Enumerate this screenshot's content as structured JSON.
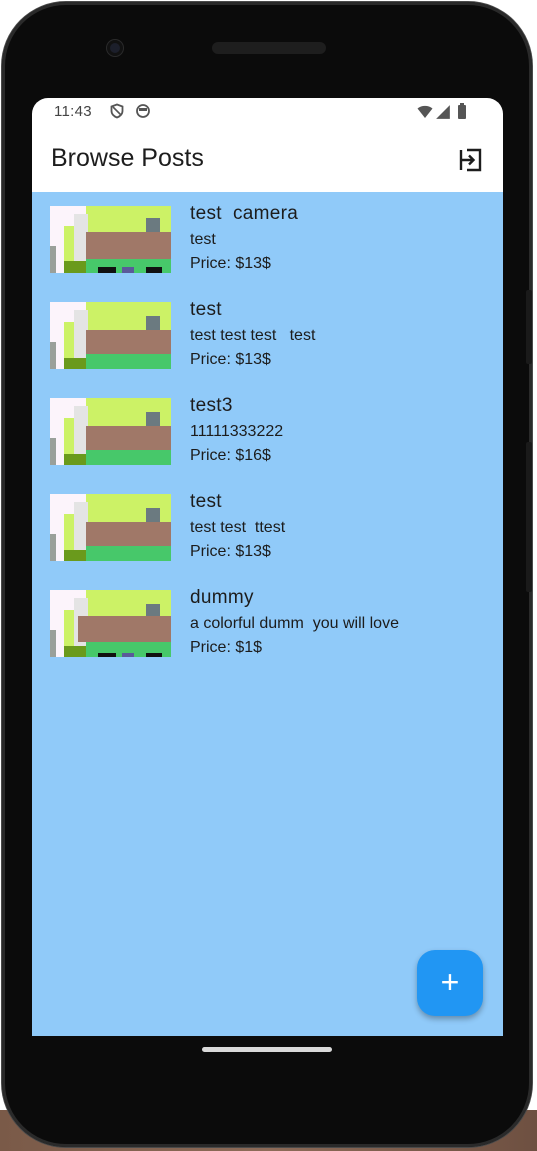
{
  "status_bar": {
    "time": "11:43",
    "left_icons": [
      "shield-icon",
      "circle-status-icon"
    ],
    "right_icons": [
      "wifi-icon",
      "cell-signal-icon",
      "battery-icon"
    ]
  },
  "app_bar": {
    "title": "Browse Posts",
    "action_icon": "logout-icon"
  },
  "posts": [
    {
      "title": "test  camera",
      "description": "test",
      "price": "Price: $13$"
    },
    {
      "title": "test",
      "description": "test test test   test",
      "price": "Price: $13$"
    },
    {
      "title": "test3",
      "description": "11111333222",
      "price": "Price: $16$"
    },
    {
      "title": "test",
      "description": "test test  ttest",
      "price": "Price: $13$"
    },
    {
      "title": "dummy",
      "description": "a colorful dumm  you will love",
      "price": "Price: $1$"
    }
  ],
  "fab": {
    "label": "+"
  },
  "colors": {
    "background": "#90caf9",
    "fab": "#2196f3",
    "app_bar": "#ffffff"
  }
}
